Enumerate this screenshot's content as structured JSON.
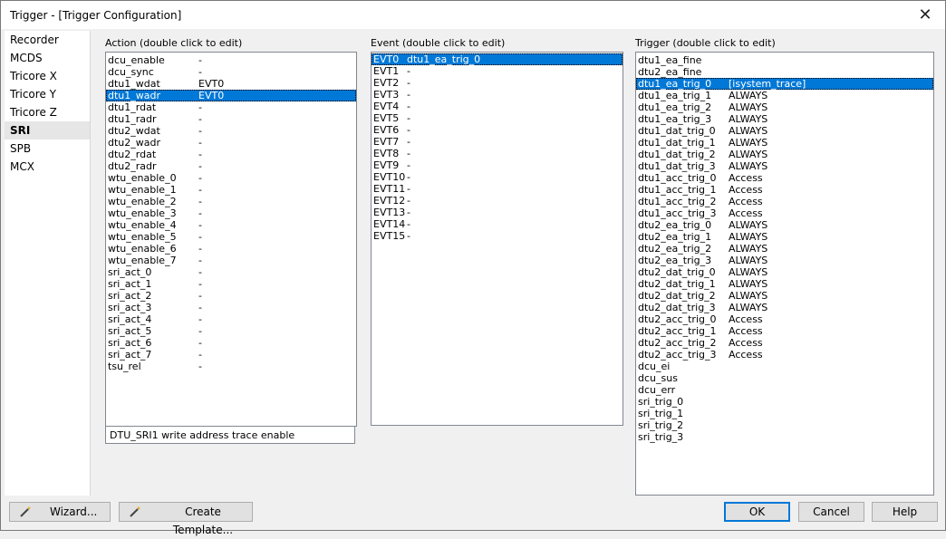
{
  "window": {
    "title": "Trigger - [Trigger Configuration]",
    "close_glyph": "✕"
  },
  "sidebar": {
    "items": [
      "Recorder",
      "MCDS",
      "Tricore X",
      "Tricore Y",
      "Tricore Z",
      "SRI",
      "SPB",
      "MCX"
    ],
    "selected": 5
  },
  "action": {
    "label": "Action (double click to edit)",
    "rows": [
      [
        "dcu_enable",
        "-"
      ],
      [
        "dcu_sync",
        "-"
      ],
      [
        "dtu1_wdat",
        "EVT0"
      ],
      [
        "dtu1_wadr",
        "EVT0"
      ],
      [
        "dtu1_rdat",
        "-"
      ],
      [
        "dtu1_radr",
        "-"
      ],
      [
        "dtu2_wdat",
        "-"
      ],
      [
        "dtu2_wadr",
        "-"
      ],
      [
        "dtu2_rdat",
        "-"
      ],
      [
        "dtu2_radr",
        "-"
      ],
      [
        "wtu_enable_0",
        "-"
      ],
      [
        "wtu_enable_1",
        "-"
      ],
      [
        "wtu_enable_2",
        "-"
      ],
      [
        "wtu_enable_3",
        "-"
      ],
      [
        "wtu_enable_4",
        "-"
      ],
      [
        "wtu_enable_5",
        "-"
      ],
      [
        "wtu_enable_6",
        "-"
      ],
      [
        "wtu_enable_7",
        "-"
      ],
      [
        "sri_act_0",
        "-"
      ],
      [
        "sri_act_1",
        "-"
      ],
      [
        "sri_act_2",
        "-"
      ],
      [
        "sri_act_3",
        "-"
      ],
      [
        "sri_act_4",
        "-"
      ],
      [
        "sri_act_5",
        "-"
      ],
      [
        "sri_act_6",
        "-"
      ],
      [
        "sri_act_7",
        "-"
      ],
      [
        "tsu_rel",
        "-"
      ]
    ],
    "selected": 3,
    "description": "DTU_SRI1 write address trace enable"
  },
  "event": {
    "label": "Event  (double click to edit)",
    "rows": [
      [
        "EVT0",
        "dtu1_ea_trig_0"
      ],
      [
        "EVT1",
        "-"
      ],
      [
        "EVT2",
        "-"
      ],
      [
        "EVT3",
        "-"
      ],
      [
        "EVT4",
        "-"
      ],
      [
        "EVT5",
        "-"
      ],
      [
        "EVT6",
        "-"
      ],
      [
        "EVT7",
        "-"
      ],
      [
        "EVT8",
        "-"
      ],
      [
        "EVT9",
        "-"
      ],
      [
        "EVT10",
        "-"
      ],
      [
        "EVT11",
        "-"
      ],
      [
        "EVT12",
        "-"
      ],
      [
        "EVT13",
        "-"
      ],
      [
        "EVT14",
        "-"
      ],
      [
        "EVT15",
        "-"
      ]
    ],
    "selected": 0
  },
  "trigger": {
    "label": "Trigger (double click to edit)",
    "rows": [
      [
        "dtu1_ea_fine",
        ""
      ],
      [
        "dtu2_ea_fine",
        ""
      ],
      [
        "dtu1_ea_trig_0",
        "[isystem_trace]"
      ],
      [
        "dtu1_ea_trig_1",
        "ALWAYS"
      ],
      [
        "dtu1_ea_trig_2",
        "ALWAYS"
      ],
      [
        "dtu1_ea_trig_3",
        "ALWAYS"
      ],
      [
        "dtu1_dat_trig_0",
        "ALWAYS"
      ],
      [
        "dtu1_dat_trig_1",
        "ALWAYS"
      ],
      [
        "dtu1_dat_trig_2",
        "ALWAYS"
      ],
      [
        "dtu1_dat_trig_3",
        "ALWAYS"
      ],
      [
        "dtu1_acc_trig_0",
        "Access"
      ],
      [
        "dtu1_acc_trig_1",
        "Access"
      ],
      [
        "dtu1_acc_trig_2",
        "Access"
      ],
      [
        "dtu1_acc_trig_3",
        "Access"
      ],
      [
        "dtu2_ea_trig_0",
        "ALWAYS"
      ],
      [
        "dtu2_ea_trig_1",
        "ALWAYS"
      ],
      [
        "dtu2_ea_trig_2",
        "ALWAYS"
      ],
      [
        "dtu2_ea_trig_3",
        "ALWAYS"
      ],
      [
        "dtu2_dat_trig_0",
        "ALWAYS"
      ],
      [
        "dtu2_dat_trig_1",
        "ALWAYS"
      ],
      [
        "dtu2_dat_trig_2",
        "ALWAYS"
      ],
      [
        "dtu2_dat_trig_3",
        "ALWAYS"
      ],
      [
        "dtu2_acc_trig_0",
        "Access"
      ],
      [
        "dtu2_acc_trig_1",
        "Access"
      ],
      [
        "dtu2_acc_trig_2",
        "Access"
      ],
      [
        "dtu2_acc_trig_3",
        "Access"
      ],
      [
        "dcu_ei",
        ""
      ],
      [
        "dcu_sus",
        ""
      ],
      [
        "dcu_err",
        ""
      ],
      [
        "sri_trig_0",
        ""
      ],
      [
        "sri_trig_1",
        ""
      ],
      [
        "sri_trig_2",
        ""
      ],
      [
        "sri_trig_3",
        ""
      ]
    ],
    "selected": 2
  },
  "buttons": {
    "wizard": "Wizard...",
    "create_template": "Create Template...",
    "ok": "OK",
    "cancel": "Cancel",
    "help": "Help",
    "wand_icon": "magic-wand-icon"
  }
}
